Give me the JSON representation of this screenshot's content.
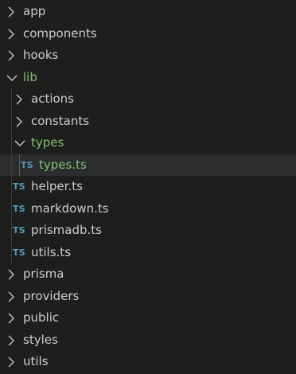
{
  "colors": {
    "background": "#1e1f1c",
    "text": "#cccccc",
    "modified_text": "#7ec16e",
    "ts_icon": "#519aba",
    "selected_row": "#2b2d2e"
  },
  "tree": {
    "app": {
      "label": "app",
      "icon": "chevron-right-icon"
    },
    "components": {
      "label": "components",
      "icon": "chevron-right-icon"
    },
    "hooks": {
      "label": "hooks",
      "icon": "chevron-right-icon"
    },
    "lib": {
      "label": "lib",
      "icon": "chevron-down-icon"
    },
    "actions": {
      "label": "actions",
      "icon": "chevron-right-icon"
    },
    "constants": {
      "label": "constants",
      "icon": "chevron-right-icon"
    },
    "types": {
      "label": "types",
      "icon": "chevron-down-icon"
    },
    "types_ts": {
      "label": "types.ts",
      "icon_text": "TS"
    },
    "helper_ts": {
      "label": "helper.ts",
      "icon_text": "TS"
    },
    "markdown_ts": {
      "label": "markdown.ts",
      "icon_text": "TS"
    },
    "prismadb_ts": {
      "label": "prismadb.ts",
      "icon_text": "TS"
    },
    "utils_ts": {
      "label": "utils.ts",
      "icon_text": "TS"
    },
    "prisma": {
      "label": "prisma",
      "icon": "chevron-right-icon"
    },
    "providers": {
      "label": "providers",
      "icon": "chevron-right-icon"
    },
    "public": {
      "label": "public",
      "icon": "chevron-right-icon"
    },
    "styles": {
      "label": "styles",
      "icon": "chevron-right-icon"
    },
    "utils": {
      "label": "utils",
      "icon": "chevron-right-icon"
    }
  }
}
